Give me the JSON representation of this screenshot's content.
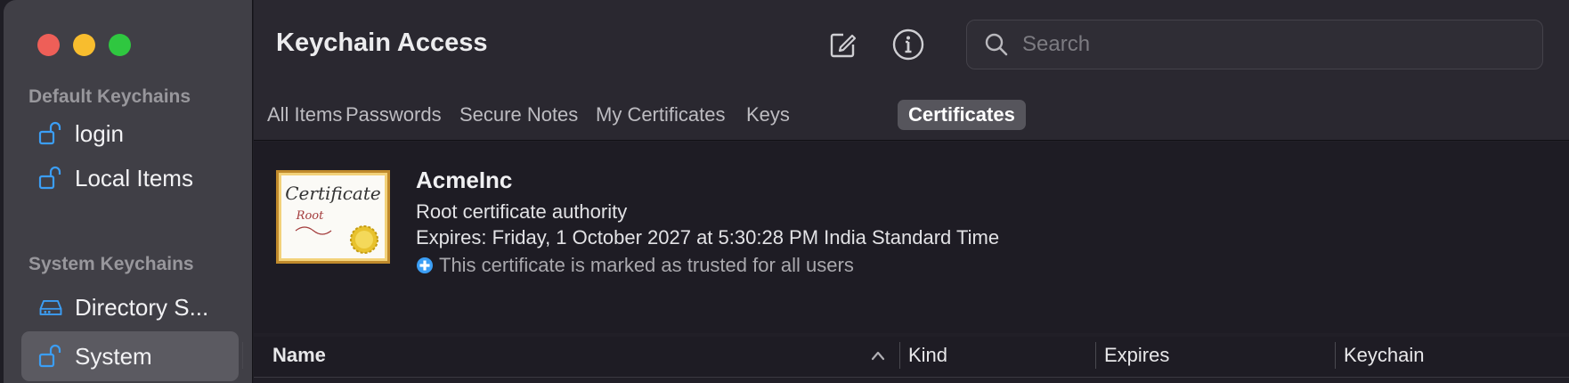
{
  "window": {
    "title": "Keychain Access"
  },
  "sidebar": {
    "default_section": "Default Keychains",
    "default_items": [
      {
        "label": "login",
        "icon": "unlock-icon"
      },
      {
        "label": "Local Items",
        "icon": "unlock-icon"
      }
    ],
    "system_section": "System Keychains",
    "system_items": [
      {
        "label": "Directory S...",
        "icon": "network-drive-icon"
      },
      {
        "label": "System",
        "icon": "unlock-icon",
        "selected": true
      }
    ]
  },
  "toolbar": {
    "compose_icon": "compose-icon",
    "info_icon": "info-icon"
  },
  "search": {
    "placeholder": "Search",
    "value": ""
  },
  "tabs": [
    {
      "label": "All Items"
    },
    {
      "label": "Passwords"
    },
    {
      "label": "Secure Notes"
    },
    {
      "label": "My Certificates"
    },
    {
      "label": "Keys"
    },
    {
      "label": "Certificates",
      "active": true
    }
  ],
  "detail": {
    "name": "AcmeInc",
    "type": "Root certificate authority",
    "expires": "Expires: Friday, 1 October 2027 at 5:30:28 PM India Standard Time",
    "trust": "This certificate is marked as trusted for all users",
    "cert_title": "Certificate",
    "cert_subtitle": "Root"
  },
  "table": {
    "columns": [
      {
        "label": "Name",
        "sorted": "ascending"
      },
      {
        "label": "Kind"
      },
      {
        "label": "Expires"
      },
      {
        "label": "Keychain"
      }
    ]
  },
  "colors": {
    "accent": "#3b9ef5",
    "close": "#ee5f58",
    "minimize": "#f8bd2e",
    "zoom": "#2fc740"
  }
}
